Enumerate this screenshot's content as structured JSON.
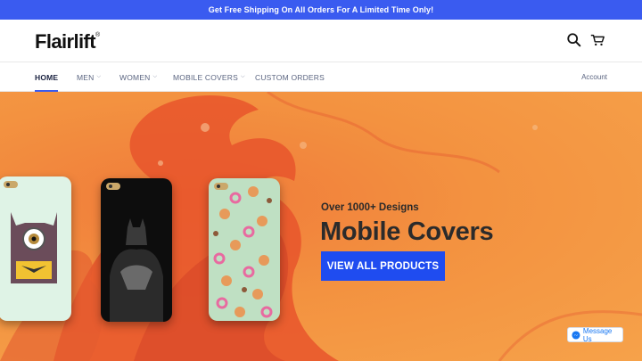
{
  "announcement": "Get Free Shipping On All Orders For A Limited Time Only!",
  "header": {
    "logo_text": "Flairlift",
    "logo_mark": "®",
    "icons": [
      "search-icon",
      "cart-icon"
    ]
  },
  "nav": {
    "items": [
      {
        "label": "HOME",
        "active": true
      },
      {
        "label": "MEN",
        "dropdown": true
      },
      {
        "label": "WOMEN",
        "dropdown": true
      },
      {
        "label": "MOBILE COVERS",
        "dropdown": true
      },
      {
        "label": "CUSTOM ORDERS"
      }
    ],
    "account_label": "Account"
  },
  "hero": {
    "eyebrow": "Over 1000+ Designs",
    "headline": "Mobile Covers",
    "cta_label": "VIEW ALL PRODUCTS",
    "covers": [
      "minion-batman-cover",
      "batman-cover",
      "cupcakes-donuts-cover"
    ]
  },
  "messenger": {
    "label": "Message Us"
  },
  "colors": {
    "accent": "#3a5bf0",
    "cta": "#1f4cf0",
    "hero_bg": "#f39240"
  }
}
